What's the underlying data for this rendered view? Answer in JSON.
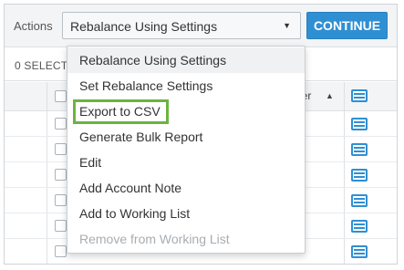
{
  "toolbar": {
    "actions_label": "Actions",
    "selected_action": "Rebalance Using Settings",
    "continue_label": "CONTINUE"
  },
  "selection": {
    "summary_text": "0 SELECTED"
  },
  "table": {
    "sort_column_label": "ber",
    "row_count": 6
  },
  "menu": {
    "items": [
      {
        "label": "Rebalance Using Settings",
        "state": "active"
      },
      {
        "label": "Set Rebalance Settings",
        "state": "normal"
      },
      {
        "label": "Export to CSV",
        "state": "highlighted"
      },
      {
        "label": "Generate Bulk Report",
        "state": "normal"
      },
      {
        "label": "Edit",
        "state": "normal"
      },
      {
        "label": "Add Account Note",
        "state": "normal"
      },
      {
        "label": "Add to Working List",
        "state": "normal"
      },
      {
        "label": "Remove from Working List",
        "state": "disabled"
      }
    ]
  },
  "colors": {
    "accent": "#2f8fd3",
    "highlight_box": "#6db33f",
    "toolbar_bg": "#f2f4f6"
  },
  "icons": {
    "caret": "caret-down-icon",
    "sort": "sort-ascending-icon",
    "column_settings": "grid-list-icon"
  }
}
